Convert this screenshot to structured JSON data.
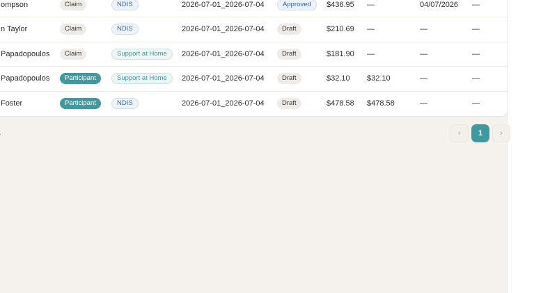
{
  "table": {
    "rows": [
      {
        "name": "ompson",
        "type": "Claim",
        "type_style": "claim",
        "funding": "NDIS",
        "funding_style": "ndis",
        "period": "2026-07-01_2026-07-04",
        "status": "Approved",
        "status_style": "approved",
        "amount": "$436.95",
        "paid": "—",
        "date": "04/07/2026",
        "extra": "—"
      },
      {
        "name": "n Taylor",
        "type": "Claim",
        "type_style": "claim",
        "funding": "NDIS",
        "funding_style": "ndis",
        "period": "2026-07-01_2026-07-04",
        "status": "Draft",
        "status_style": "draft",
        "amount": "$210.69",
        "paid": "—",
        "date": "—",
        "extra": "—"
      },
      {
        "name": "Papadopoulos",
        "type": "Claim",
        "type_style": "claim",
        "funding": "Support at Home",
        "funding_style": "sah",
        "period": "2026-07-01_2026-07-04",
        "status": "Draft",
        "status_style": "draft",
        "amount": "$181.90",
        "paid": "—",
        "date": "—",
        "extra": "—"
      },
      {
        "name": "Papadopoulos",
        "type": "Participant",
        "type_style": "participant",
        "funding": "Support at Home",
        "funding_style": "sah",
        "period": "2026-07-01_2026-07-04",
        "status": "Draft",
        "status_style": "draft",
        "amount": "$32.10",
        "paid": "$32.10",
        "date": "—",
        "extra": "—"
      },
      {
        "name": "Foster",
        "type": "Participant",
        "type_style": "participant",
        "funding": "NDIS",
        "funding_style": "ndis",
        "period": "2026-07-01_2026-07-04",
        "status": "Draft",
        "status_style": "draft",
        "amount": "$478.58",
        "paid": "$478.58",
        "date": "—",
        "extra": "—"
      }
    ]
  },
  "pagination": {
    "prev_icon": "chevron-left-icon",
    "next_icon": "chevron-right-icon",
    "prev_glyph": "‹",
    "next_glyph": "›",
    "current_page": "1"
  },
  "colors": {
    "accent": "#3f9aa0",
    "background": "#f5f2ed",
    "card": "#ffffff"
  }
}
